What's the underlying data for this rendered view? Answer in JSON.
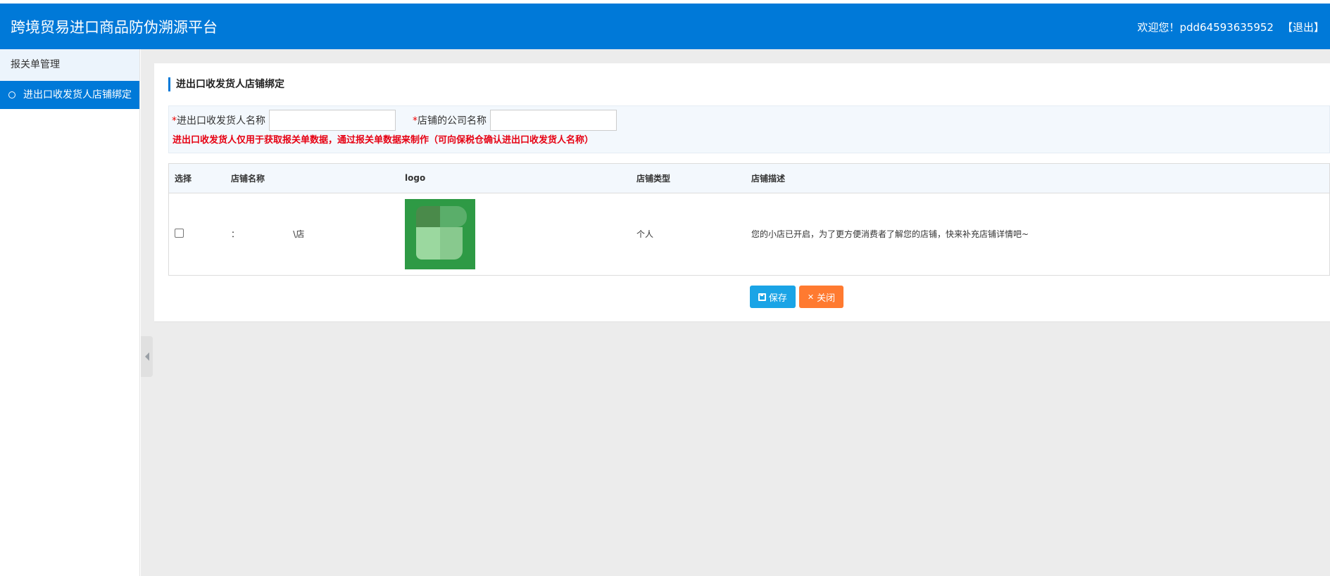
{
  "header": {
    "title": "跨境贸易进口商品防伪溯源平台",
    "welcome_prefix": "欢迎您！",
    "username": "pdd64593635952",
    "logout": "【退出】"
  },
  "sidebar": {
    "group": "报关单管理",
    "items": [
      {
        "label": "进出口收发货人店铺绑定"
      }
    ]
  },
  "panel": {
    "title": "进出口收发货人店铺绑定",
    "form": {
      "consignee_label": "进出口收发货人名称",
      "consignee_value": "",
      "company_label": "店铺的公司名称",
      "company_value": "",
      "required_mark": "*",
      "warning": "进出口收发货人仅用于获取报关单数据，通过报关单数据来制作（可向保税仓确认进出口收发货人名称）"
    },
    "table": {
      "headers": [
        "选择",
        "店铺名称",
        "logo",
        "店铺类型",
        "店铺描述"
      ],
      "rows": [
        {
          "shop_name": "：                    \\店",
          "shop_type": "个人",
          "description": "您的小店已开启，为了更方便消费者了解您的店铺，快来补充店铺详情吧~"
        }
      ]
    },
    "buttons": {
      "save": "保存",
      "close": "关闭"
    }
  },
  "colors": {
    "brand": "#0079d8",
    "save": "#1aa4e6",
    "close": "#ff7a30",
    "warning": "#e60012"
  }
}
